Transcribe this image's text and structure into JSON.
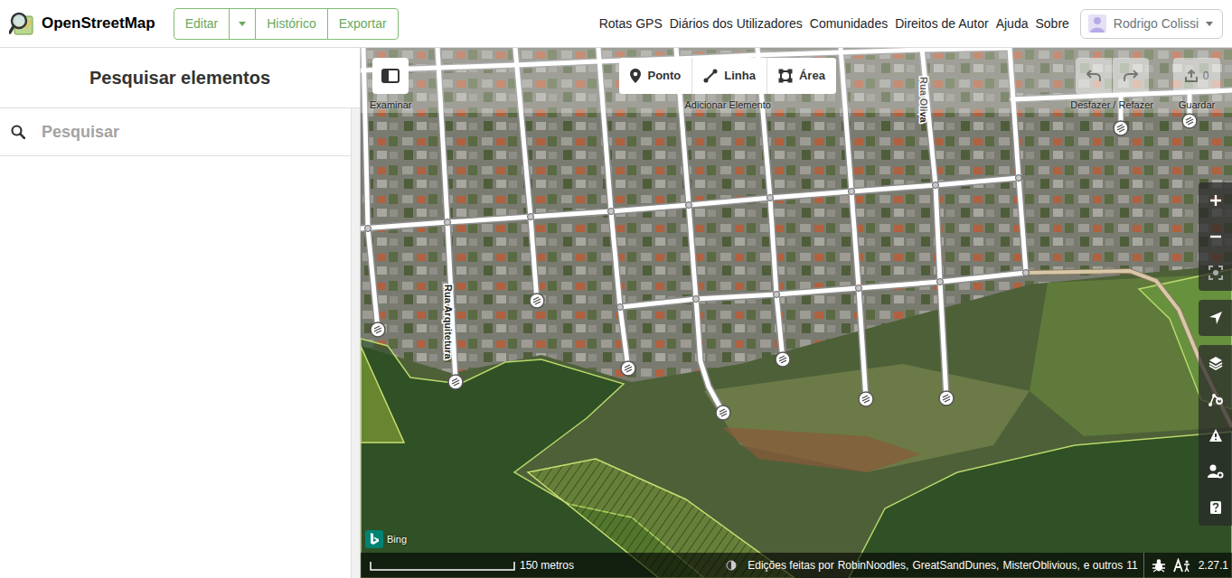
{
  "header": {
    "brand": "OpenStreetMap",
    "edit_buttons": [
      "Editar",
      "Histórico",
      "Exportar"
    ],
    "nav_links": [
      "Rotas GPS",
      "Diários dos Utilizadores",
      "Comunidades",
      "Direitos de Autor",
      "Ajuda",
      "Sobre"
    ],
    "user": {
      "name": "Rodrigo Colissi"
    }
  },
  "sidebar": {
    "title": "Pesquisar elementos",
    "search": {
      "placeholder": "Pesquisar"
    }
  },
  "map": {
    "toolbar": {
      "examine_label": "Examinar",
      "add_label": "Adicionar Elemento",
      "modes": [
        {
          "label": "Ponto",
          "selected": false
        },
        {
          "label": "Linha",
          "selected": false
        },
        {
          "label": "Área",
          "selected": false
        }
      ],
      "history_label": "Desfazer / Refazer",
      "undo": {
        "disabled": true
      },
      "redo": {
        "disabled": true
      },
      "save": {
        "label": "Guardar",
        "count": "0",
        "disabled": true
      }
    },
    "streets": [
      {
        "name": "Rua Arquitetura"
      },
      {
        "name": "Rua Oliva"
      }
    ],
    "imagery": {
      "name": "Bing"
    },
    "footer": {
      "scale": "150 metros",
      "attribution": {
        "prefix": "Edições feitas por",
        "users": [
          "RobinNoodles,",
          "GreatSandDunes,",
          "MisterOblivious,"
        ],
        "more_prefix": "e outros",
        "more_count": "11"
      },
      "version": "2.27.1"
    }
  }
}
